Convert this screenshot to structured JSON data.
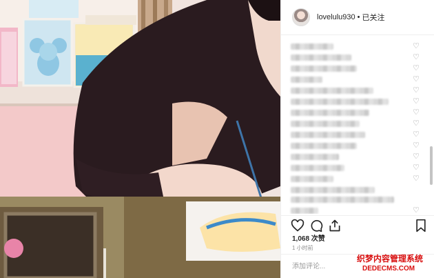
{
  "post": {
    "username": "lovelulu930",
    "separator": "•",
    "follow_label": "已关注",
    "likes": "1,068 次赞",
    "time": "1 小时前",
    "comment_placeholder": "添加评论..."
  },
  "comments": [
    {
      "blurred": true
    },
    {
      "blurred": true
    },
    {
      "blurred": true
    },
    {
      "blurred": true
    },
    {
      "blurred": true
    },
    {
      "blurred": true
    },
    {
      "blurred": true
    },
    {
      "blurred": true
    },
    {
      "blurred": true
    },
    {
      "blurred": true
    },
    {
      "blurred": true
    },
    {
      "blurred": true
    },
    {
      "blurred": true
    },
    {
      "blurred": true
    },
    {
      "blurred": true
    },
    {
      "blurred": true
    }
  ],
  "icons": {
    "heart": "heart-icon",
    "comment": "comment-icon",
    "share": "share-icon",
    "save": "bookmark-icon"
  },
  "watermark": {
    "line1": "织梦内容管理系统",
    "line2": "DEDECMS.COM"
  },
  "colors": {
    "text": "#262626",
    "muted": "#8e8e8e",
    "border": "#efefef",
    "watermark": "#d80f0f"
  }
}
